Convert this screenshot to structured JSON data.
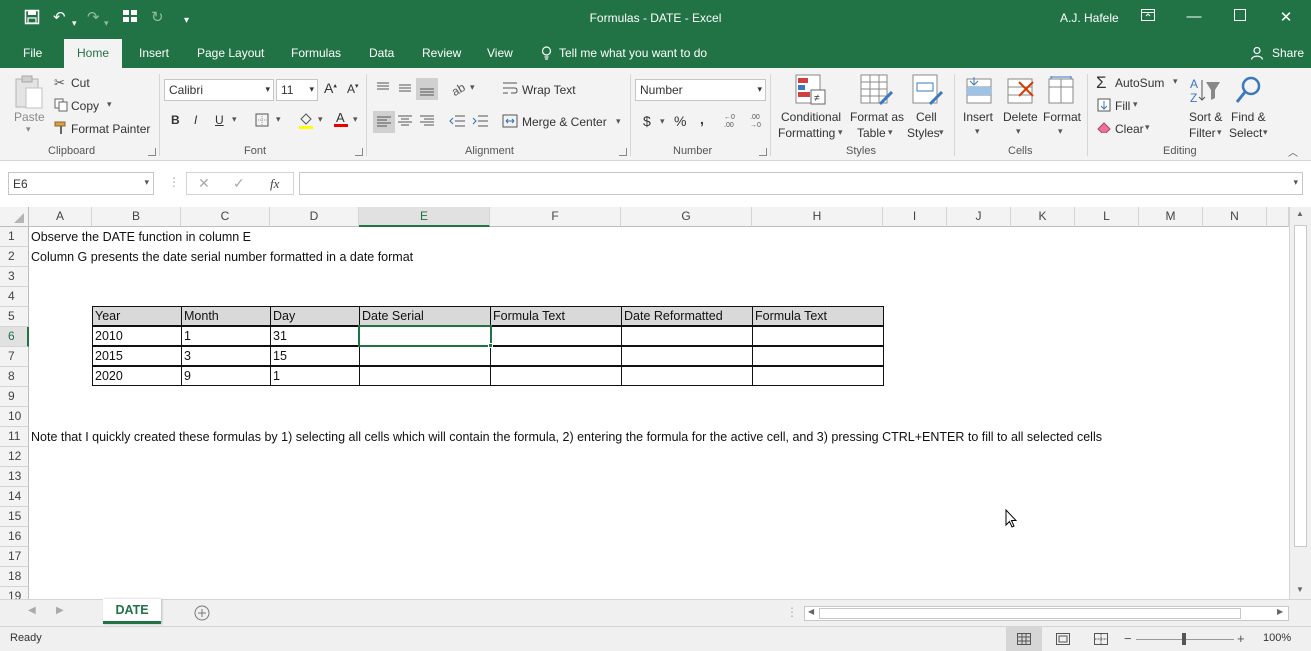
{
  "window": {
    "title": "Formulas - DATE  -  Excel",
    "user": "A.J. Hafele"
  },
  "menu": {
    "file": "File",
    "tabs": [
      "Home",
      "Insert",
      "Page Layout",
      "Formulas",
      "Data",
      "Review",
      "View"
    ],
    "tell_me": "Tell me what you want to do",
    "share": "Share"
  },
  "ribbon": {
    "clipboard": {
      "paste": "Paste",
      "cut": "Cut",
      "copy": "Copy",
      "format_painter": "Format Painter",
      "label": "Clipboard"
    },
    "font": {
      "name": "Calibri",
      "size": "11",
      "bold": "B",
      "italic": "I",
      "underline": "U",
      "label": "Font"
    },
    "alignment": {
      "wrap_text": "Wrap Text",
      "merge_center": "Merge & Center",
      "label": "Alignment"
    },
    "number": {
      "format": "Number",
      "currency": "$",
      "percent": "%",
      "comma": ",",
      "label": "Number"
    },
    "styles": {
      "conditional_1": "Conditional",
      "conditional_2": "Formatting",
      "format_as_1": "Format as",
      "format_as_2": "Table",
      "cell_styles_1": "Cell",
      "cell_styles_2": "Styles",
      "label": "Styles"
    },
    "cells": {
      "insert": "Insert",
      "delete": "Delete",
      "format": "Format",
      "label": "Cells"
    },
    "editing": {
      "autosum": "AutoSum",
      "fill": "Fill",
      "clear": "Clear",
      "sort_1": "Sort &",
      "sort_2": "Filter",
      "find_1": "Find &",
      "find_2": "Select",
      "label": "Editing"
    }
  },
  "formula_bar": {
    "name_box": "E6",
    "fx": "fx",
    "content": ""
  },
  "grid": {
    "columns": [
      "A",
      "B",
      "C",
      "D",
      "E",
      "F",
      "G",
      "H",
      "I",
      "J",
      "K",
      "L",
      "M",
      "N"
    ],
    "selected_column": "E",
    "rows": [
      "1",
      "2",
      "3",
      "4",
      "5",
      "6",
      "7",
      "8",
      "9",
      "10",
      "11",
      "12",
      "13",
      "14",
      "15",
      "16",
      "17",
      "18",
      "19"
    ],
    "selected_row": "6",
    "a1": "Observe the DATE function in column E",
    "a2": "Column G presents the date serial number formatted in a date format",
    "a11": "Note that I quickly created these formulas by 1) selecting all cells which will contain the formula, 2) entering the formula for the active cell, and 3) pressing CTRL+ENTER to fill to all selected cells",
    "table": {
      "headers": [
        "Year",
        "Month",
        "Day",
        "Date Serial",
        "Formula Text",
        "Date Reformatted",
        "Formula Text"
      ],
      "rows": [
        [
          "2010",
          "1",
          "31",
          "",
          "",
          "",
          ""
        ],
        [
          "2015",
          "3",
          "15",
          "",
          "",
          "",
          ""
        ],
        [
          "2020",
          "9",
          "1",
          "",
          "",
          "",
          ""
        ]
      ]
    }
  },
  "sheets": {
    "active": "DATE"
  },
  "status": {
    "ready": "Ready",
    "zoom": "100%"
  },
  "colors": {
    "brand": "#217346",
    "table_header_fill": "#d9d9d9"
  }
}
